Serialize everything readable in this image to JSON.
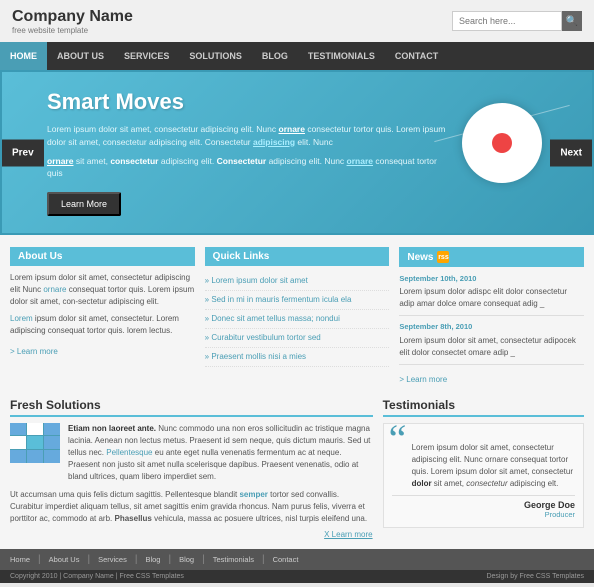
{
  "header": {
    "company_name": "Company Name",
    "tagline": "free website template",
    "search_placeholder": "Search here..."
  },
  "nav": {
    "items": [
      {
        "label": "HOME",
        "active": true
      },
      {
        "label": "ABOUT US",
        "active": false
      },
      {
        "label": "SERVICES",
        "active": false
      },
      {
        "label": "SOLUTIONS",
        "active": false
      },
      {
        "label": "BLOG",
        "active": false
      },
      {
        "label": "TESTIMONIALS",
        "active": false
      },
      {
        "label": "CONTACT",
        "active": false
      }
    ]
  },
  "slider": {
    "title": "Smart Moves",
    "text1": "Lorem ipsum dolor sit amet, consectetur adipiscing elit. Nunc ornare consectetur tortor quis. Lorem ipsum dolor sit amet, consectetur adipiscing elit. Consectetur adipiscing elit. Nunc",
    "link1": "ornare",
    "text2": "sit amet, consectetur adipiscing elit. Consectetur adipiscing elit. Nunc ornare consequat tortor quis",
    "link2": "ornare",
    "learn_more": "Learn More",
    "prev": "Prev",
    "next": "Next"
  },
  "about_us": {
    "title": "About Us",
    "text1": "Lorem ipsum dolor sit amet, consectetur adipiscing elit Nunc ornare consequat tortor quis. Lorem ipsum dolor sit amet, con-sectetur adipiscing elit.",
    "link1": "ornare",
    "text2": "Lorem ipsum dolor sit amet, consectetur. Lorem adipiscing consequat tortor quis. lorem lectus.",
    "link2": "Lorem",
    "learn_more": "Learn more"
  },
  "quick_links": {
    "title": "Quick Links",
    "items": [
      "Lorem ipsum dolor sit amet",
      "Sed in mi in mauris fermentum icula ela",
      "Donec sit amet tellus massa; nondui",
      "Curabitur vestibulum tortor sed",
      "Praesent mollis nisi a mies"
    ]
  },
  "news": {
    "title": "News",
    "items": [
      {
        "date": "September 10th, 2010",
        "text": "Lorem ipsum dolor adispc elit dolor consectetur adip amar dolce omare consequat adig _"
      },
      {
        "date": "September 8th, 2010",
        "text": "Lorem ipsum dolor sit amet, consectetur adipocek elit dolor consectet omare adip _"
      }
    ],
    "learn_more": "Learn more"
  },
  "fresh_solutions": {
    "title": "Fresh Solutions",
    "intro_bold": "Etiam non laoreet ante.",
    "intro_text": " Nunc commodo una non eros sollicitudin ac tristique magna lacinia. Aenean non lectus metus. Praesent id sem neque, quis dictum mauris. Sed ut tellus nec. Pellentesque eu ante eget nulla venenatis fermentum ac at neque. Praesent non justo sit amet nulla scelerisque dapibus. Praesent venenatis, odio at bland ultrices, quam libero imperdiet sem.",
    "full_text": "Ut accumsan uma quis felis dictum sagittis. Pellentesque blandit semper tortor sed convallis. Curabitur imperdiet aliquam tellus, sit amet sagittis enim gravida rhoncus. Nam purus felis, viverra et porttitor ac, commodo at arb. Phasellus vehicula, massa ac posuere ultrices, nisl turpis eleifend una.",
    "link": "semper",
    "learn_more": "X Learn more"
  },
  "testimonials": {
    "title": "Testimonials",
    "text": "Lorem ipsum dolor sit amet, consectetur adipiscing elit. Nunc ornare consequat tortor quis. Lorem ipsum dolor sit amet, consectetur adipiscing elit.",
    "bold_word": "dolor",
    "author_name": "George Doe",
    "author_title": "Producer"
  },
  "footer": {
    "links": [
      "Home",
      "About Us",
      "Services",
      "Blog",
      "Blog",
      "Testimonials",
      "Contact"
    ],
    "copyright": "Copyright 2010 | Company Name | Free CSS Templates",
    "designer": "Design by Free CSS Templates"
  }
}
